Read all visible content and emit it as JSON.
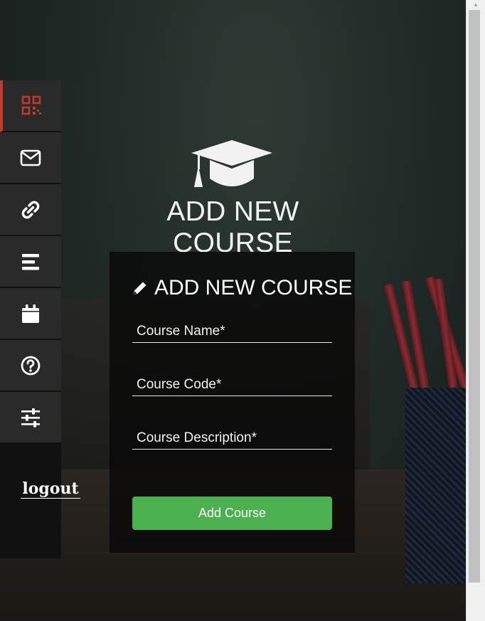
{
  "page": {
    "title": "ADD NEW COURSE"
  },
  "sidebar": {
    "items": [
      {
        "name": "dashboard",
        "icon": "qr-grid-icon",
        "active": true
      },
      {
        "name": "messages",
        "icon": "envelope-icon",
        "active": false
      },
      {
        "name": "links",
        "icon": "link-icon",
        "active": false
      },
      {
        "name": "courses",
        "icon": "align-bars-icon",
        "active": false
      },
      {
        "name": "calendar",
        "icon": "calendar-icon",
        "active": false
      },
      {
        "name": "help",
        "icon": "question-circle-icon",
        "active": false
      },
      {
        "name": "settings",
        "icon": "sliders-icon",
        "active": false
      }
    ],
    "logout_label": "logout"
  },
  "form": {
    "title": "ADD NEW COURSE",
    "course_name_placeholder": "Course Name*",
    "course_code_placeholder": "Course Code*",
    "course_description_placeholder": "Course Description*",
    "submit_label": "Add Course"
  },
  "colors": {
    "accent_active": "#c0392b",
    "submit_button": "#4caf50",
    "sidebar_item": "#2a2a2a",
    "card_bg": "rgba(8,8,8,0.78)"
  }
}
